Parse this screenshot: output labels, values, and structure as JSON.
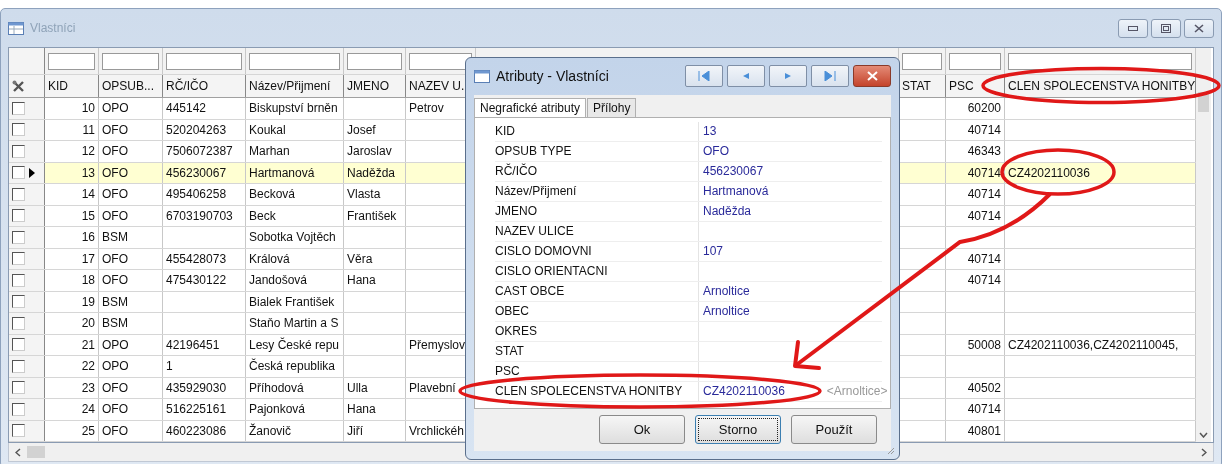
{
  "window": {
    "title": "Vlastníci"
  },
  "table": {
    "columns": [
      "KID",
      "OPSUB...",
      "RČ/IČO",
      "Název/Přijmení",
      "JMENO",
      "NAZEV U.",
      "STAT",
      "PSC",
      "CLEN SPOLECENSTVA HONITBY"
    ],
    "rows": [
      {
        "checked": false,
        "selected": false,
        "kid": "10",
        "opsub": "OPO",
        "rc_ico": "445142",
        "nazev": "Biskupství brněn",
        "nazev_ulice": "Petrov",
        "psc": "60200"
      },
      {
        "checked": false,
        "selected": false,
        "kid": "11",
        "opsub": "OFO",
        "rc_ico": "520204263",
        "nazev": "Koukal",
        "jmeno": "Josef",
        "psc": "40714"
      },
      {
        "checked": false,
        "selected": false,
        "kid": "12",
        "opsub": "OFO",
        "rc_ico": "7506072387",
        "nazev": "Marhan",
        "jmeno": "Jaroslav",
        "psc": "46343"
      },
      {
        "checked": false,
        "selected": true,
        "kid": "13",
        "opsub": "OFO",
        "rc_ico": "456230067",
        "nazev": "Hartmanová",
        "jmeno": "Naděžda",
        "psc": "40714",
        "clen": "CZ4202110036"
      },
      {
        "checked": false,
        "selected": false,
        "kid": "14",
        "opsub": "OFO",
        "rc_ico": "495406258",
        "nazev": "Becková",
        "jmeno": "Vlasta",
        "psc": "40714"
      },
      {
        "checked": false,
        "selected": false,
        "kid": "15",
        "opsub": "OFO",
        "rc_ico": "6703190703",
        "nazev": "Beck",
        "jmeno": "František",
        "psc": "40714"
      },
      {
        "checked": false,
        "selected": false,
        "kid": "16",
        "opsub": "BSM",
        "nazev": "Sobotka Vojtěch"
      },
      {
        "checked": false,
        "selected": false,
        "kid": "17",
        "opsub": "OFO",
        "rc_ico": "455428073",
        "nazev": "Králová",
        "jmeno": "Věra",
        "psc": "40714"
      },
      {
        "checked": false,
        "selected": false,
        "kid": "18",
        "opsub": "OFO",
        "rc_ico": "475430122",
        "nazev": "Jandošová",
        "jmeno": "Hana",
        "psc": "40714"
      },
      {
        "checked": false,
        "selected": false,
        "kid": "19",
        "opsub": "BSM",
        "nazev": "Bialek František"
      },
      {
        "checked": false,
        "selected": false,
        "kid": "20",
        "opsub": "BSM",
        "nazev": "Staňo Martin a S"
      },
      {
        "checked": false,
        "selected": false,
        "kid": "21",
        "opsub": "OPO",
        "rc_ico": "42196451",
        "nazev": "Lesy České repu",
        "nazev_ulice": "Přemyslov",
        "psc": "50008",
        "clen": "CZ4202110036,CZ4202110045,"
      },
      {
        "checked": false,
        "selected": false,
        "kid": "22",
        "opsub": "OPO",
        "rc_ico": "1",
        "nazev": "Česká republika"
      },
      {
        "checked": false,
        "selected": false,
        "kid": "23",
        "opsub": "OFO",
        "rc_ico": "435929030",
        "nazev": "Příhodová",
        "jmeno": "Ulla",
        "nazev_ulice": "Plavební",
        "psc": "40502"
      },
      {
        "checked": false,
        "selected": false,
        "kid": "24",
        "opsub": "OFO",
        "rc_ico": "516225161",
        "nazev": "Pajonková",
        "jmeno": "Hana",
        "psc": "40714"
      },
      {
        "checked": false,
        "selected": false,
        "kid": "25",
        "opsub": "OFO",
        "rc_ico": "460223086",
        "nazev": "Žanovič",
        "jmeno": "Jiří",
        "nazev_ulice": "Vrchlickéh",
        "psc": "40801"
      }
    ]
  },
  "dialog": {
    "title": "Atributy - Vlastníci",
    "tabs": [
      {
        "label": "Negrafické atributy",
        "selected": true
      },
      {
        "label": "Přílohy",
        "selected": false
      }
    ],
    "properties": [
      {
        "label": "KID",
        "value": "13"
      },
      {
        "label": "OPSUB TYPE",
        "value": "OFO"
      },
      {
        "label": "RČ/IČO",
        "value": "456230067"
      },
      {
        "label": "Název/Přijmení",
        "value": "Hartmanová"
      },
      {
        "label": "JMENO",
        "value": "Naděžda"
      },
      {
        "label": "NAZEV ULICE"
      },
      {
        "label": "CISLO DOMOVNI",
        "value": "107"
      },
      {
        "label": "CISLO ORIENTACNI"
      },
      {
        "label": "CAST OBCE",
        "value": "Arnoltice"
      },
      {
        "label": "OBEC",
        "value": "Arnoltice"
      },
      {
        "label": "OKRES"
      },
      {
        "label": "STAT"
      },
      {
        "label": "PSC"
      },
      {
        "label": "CLEN SPOLECENSTVA HONITBY",
        "value": "CZ4202110036",
        "hint": "<Arnoltice>"
      }
    ],
    "buttons": [
      {
        "label": "Ok",
        "focused": false
      },
      {
        "label": "Storno",
        "focused": true
      },
      {
        "label": "Použít",
        "focused": false
      }
    ]
  }
}
